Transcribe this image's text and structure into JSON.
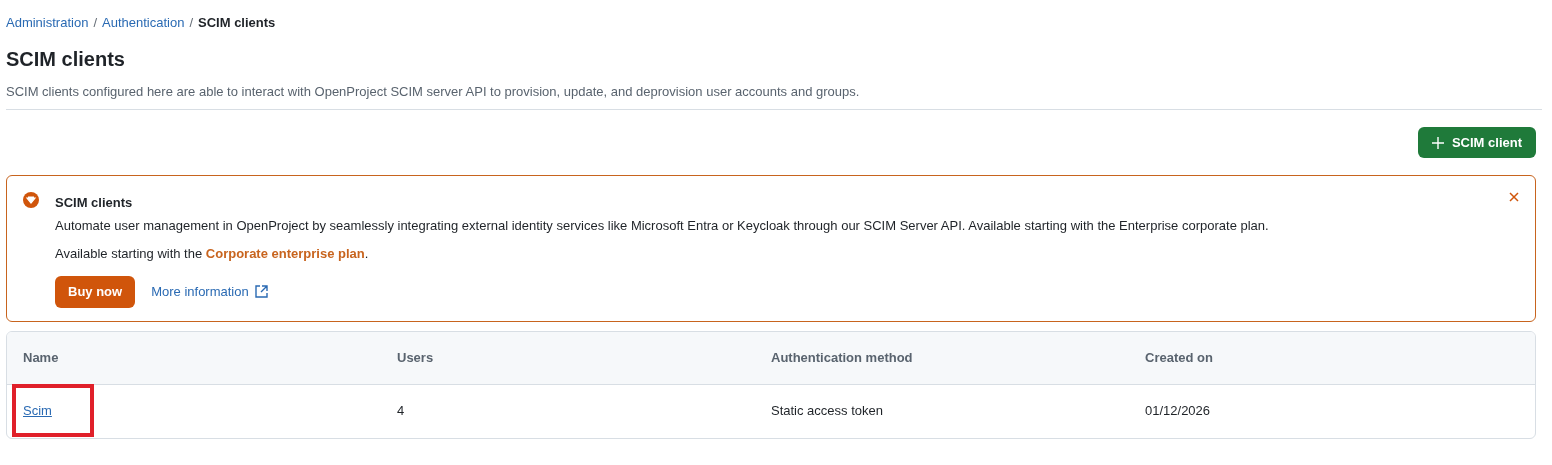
{
  "breadcrumb_separator": "/",
  "breadcrumb": [
    {
      "label": "Administration",
      "link": true
    },
    {
      "label": "Authentication",
      "link": true
    },
    {
      "label": "SCIM clients",
      "link": false
    }
  ],
  "title": "SCIM clients",
  "description": "SCIM clients configured here are able to interact with OpenProject SCIM server API to provision, update, and deprovision user accounts and groups.",
  "add_button": "SCIM client",
  "banner": {
    "title": "SCIM clients",
    "text": "Automate user management in OpenProject by seamlessly integrating external identity services like Microsoft Entra or Keycloak through our SCIM Server API. Available starting with the Enterprise corporate plan.",
    "plan_prefix": "Available starting with the ",
    "plan_link": "Corporate enterprise plan",
    "plan_suffix": ".",
    "buy_button": "Buy now",
    "more_link": "More information"
  },
  "table": {
    "columns": [
      "Name",
      "Users",
      "Authentication method",
      "Created on"
    ],
    "rows": [
      [
        "Scim",
        "4",
        "Static access token",
        "01/12/2026"
      ]
    ]
  }
}
